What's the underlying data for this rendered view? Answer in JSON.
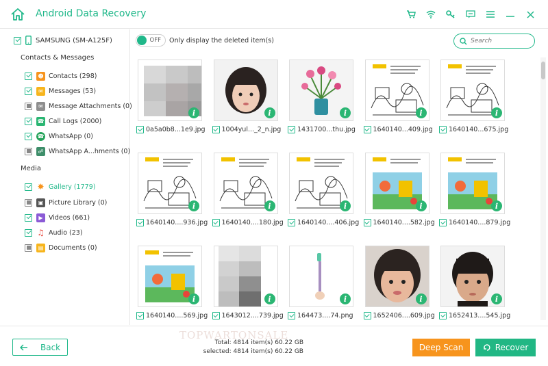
{
  "app": {
    "title": "Android Data Recovery",
    "accent": "#20b88a",
    "titlebar_icons": [
      "cart-icon",
      "wifi-icon",
      "key-icon",
      "feedback-icon",
      "menu-icon",
      "minimize-icon",
      "close-icon"
    ]
  },
  "sidebar": {
    "device": "SAMSUNG (SM-A125F)",
    "sections": [
      {
        "title": "Contacts & Messages",
        "items": [
          {
            "label": "Contacts (298)",
            "checked": true,
            "icon": "contacts-icon",
            "color": "#f7941d"
          },
          {
            "label": "Messages (53)",
            "checked": true,
            "icon": "messages-icon",
            "color": "#f7b51d"
          },
          {
            "label": "Message Attachments (0)",
            "checked": false,
            "icon": "attachment-icon",
            "color": "#8e8e8e"
          },
          {
            "label": "Call Logs (2000)",
            "checked": true,
            "icon": "phone-icon",
            "color": "#2bb673"
          },
          {
            "label": "WhatsApp (0)",
            "checked": false,
            "icon": "whatsapp-icon",
            "color": "#25a35a"
          },
          {
            "label": "WhatsApp A...hments (0)",
            "checked": false,
            "icon": "whatsapp-attachment-icon",
            "color": "#3e8e6a"
          }
        ]
      },
      {
        "title": "Media",
        "items": [
          {
            "label": "Gallery (1779)",
            "checked": true,
            "icon": "gallery-icon",
            "color": "#f7941d",
            "active": true
          },
          {
            "label": "Picture Library (0)",
            "checked": false,
            "icon": "picture-library-icon",
            "color": "#555555"
          },
          {
            "label": "Videos (661)",
            "checked": true,
            "icon": "videos-icon",
            "color": "#8b5bd6"
          },
          {
            "label": "Audio (23)",
            "checked": true,
            "icon": "audio-icon",
            "color": "#e8443a"
          },
          {
            "label": "Documents (0)",
            "checked": false,
            "icon": "documents-icon",
            "color": "#f7b51d"
          }
        ]
      }
    ]
  },
  "toolbar": {
    "toggle_state": "OFF",
    "toggle_label": "Only display the deleted item(s)",
    "search_placeholder": "Search"
  },
  "files": [
    {
      "name": "0a5a0b8...1e9.jpg",
      "thumb": "pixelated"
    },
    {
      "name": "1004yul..._2_n.jpg",
      "thumb": "photo-girl"
    },
    {
      "name": "1431700...thu.jpg",
      "thumb": "flowers"
    },
    {
      "name": "1640140...409.jpg",
      "thumb": "sketch"
    },
    {
      "name": "1640140...675.jpg",
      "thumb": "sketch"
    },
    {
      "name": "1640140....936.jpg",
      "thumb": "sketch"
    },
    {
      "name": "1640140....180.jpg",
      "thumb": "sketch"
    },
    {
      "name": "1640140....406.jpg",
      "thumb": "sketch"
    },
    {
      "name": "1640140....582.jpg",
      "thumb": "color-sketch"
    },
    {
      "name": "1640140....879.jpg",
      "thumb": "color-sketch"
    },
    {
      "name": "1640140....569.jpg",
      "thumb": "color-sketch"
    },
    {
      "name": "1643012....739.jpg",
      "thumb": "pixelated-tall"
    },
    {
      "name": "164473....74.png",
      "thumb": "toothbrush"
    },
    {
      "name": "1652406....609.jpg",
      "thumb": "photo-girl2"
    },
    {
      "name": "1652413....545.jpg",
      "thumb": "photo-boy"
    }
  ],
  "footer": {
    "back_label": "Back",
    "total": "Total: 4814 item(s) 60.22 GB",
    "selected": "selected: 4814 item(s) 60.22 GB",
    "watermark": "TOPWARTONSALE",
    "deep_scan_label": "Deep Scan",
    "recover_label": "Recover",
    "deep_scan_color": "#f7941d",
    "recover_color": "#21b784"
  }
}
